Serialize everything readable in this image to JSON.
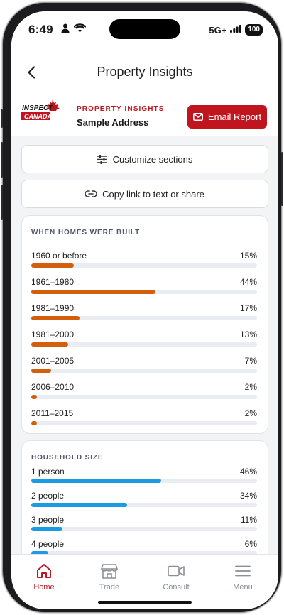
{
  "status": {
    "time": "6:49",
    "network": "5G+",
    "battery": "100"
  },
  "header": {
    "title": "Property Insights"
  },
  "brand": {
    "logo_line1": "INSPECT",
    "logo_line2": "CANADA",
    "eyebrow": "PROPERTY INSIGHTS",
    "address": "Sample Address",
    "email_label": "Email Report",
    "accent": "#c0151f"
  },
  "actions": {
    "customize_label": "Customize sections",
    "share_label": "Copy link to text or share"
  },
  "homes_built": {
    "title": "WHEN HOMES WERE BUILT",
    "color": "#d35f0e",
    "rows": [
      {
        "label": "1960 or before",
        "pct_text": "15%",
        "fraction": 0.15
      },
      {
        "label": "1961–1980",
        "pct_text": "44%",
        "fraction": 0.44
      },
      {
        "label": "1981–1990",
        "pct_text": "17%",
        "fraction": 0.17
      },
      {
        "label": "1981–2000",
        "pct_text": "13%",
        "fraction": 0.13
      },
      {
        "label": "2001–2005",
        "pct_text": "7%",
        "fraction": 0.07
      },
      {
        "label": "2006–2010",
        "pct_text": "2%",
        "fraction": 0.02
      },
      {
        "label": "2011–2015",
        "pct_text": "2%",
        "fraction": 0.02
      }
    ]
  },
  "household_size": {
    "title": "HOUSEHOLD SIZE",
    "color": "#1a9be2",
    "rows": [
      {
        "label": "1 person",
        "pct_text": "46%",
        "fraction": 0.46
      },
      {
        "label": "2 people",
        "pct_text": "34%",
        "fraction": 0.34
      },
      {
        "label": "3 people",
        "pct_text": "11%",
        "fraction": 0.11
      },
      {
        "label": "4 people",
        "pct_text": "6%",
        "fraction": 0.06
      }
    ]
  },
  "nav": {
    "items": [
      {
        "label": "Home",
        "icon": "home-icon",
        "active": true
      },
      {
        "label": "Trade",
        "icon": "storefront-icon",
        "active": false
      },
      {
        "label": "Consult",
        "icon": "video-camera-icon",
        "active": false
      },
      {
        "label": "Menu",
        "icon": "hamburger-menu-icon",
        "active": false
      }
    ]
  }
}
